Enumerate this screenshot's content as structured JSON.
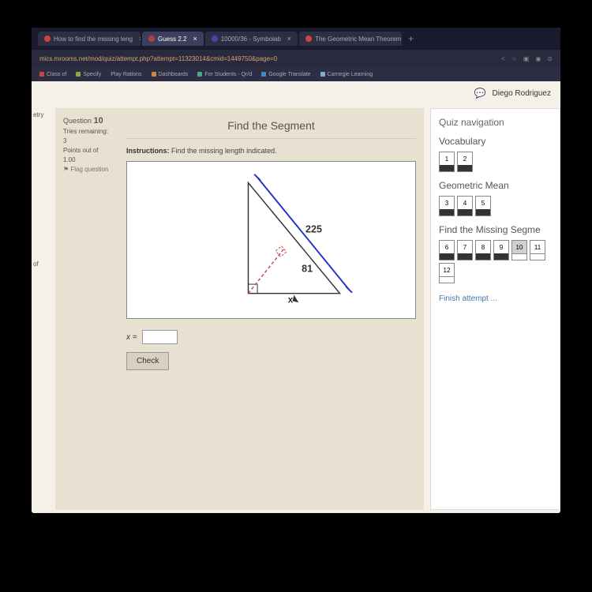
{
  "browser": {
    "tabs": [
      {
        "label": "How to find the missing leng",
        "active": false
      },
      {
        "label": "Guess 2.2",
        "active": true
      },
      {
        "label": "10000/36 - Symbolab",
        "active": false
      },
      {
        "label": "The Geometric Mean Theorem",
        "active": false
      }
    ],
    "url": "mics.mrooms.net/mod/quiz/attempt.php?attempt=11323014&cmid=1449750&page=0"
  },
  "bookmarks": [
    {
      "label": "Class of",
      "color": "#c44"
    },
    {
      "label": "Specify",
      "color": "#8a4"
    },
    {
      "label": "Play Rations",
      "color": "#888"
    },
    {
      "label": "Dashboards",
      "color": "#c84"
    },
    {
      "label": "For Students - Qr/d",
      "color": "#4a8"
    },
    {
      "label": "Google Translate",
      "color": "#48c"
    },
    {
      "label": "Carnegie Learning",
      "color": "#8ac"
    }
  ],
  "user": {
    "name": "Diego Rodriguez"
  },
  "leftNav": {
    "item1": "etry",
    "item2": "of"
  },
  "question": {
    "number": "10",
    "questionLabel": "Question",
    "triesLabel": "Tries remaining:",
    "triesValue": "3",
    "pointsLabel": "Points out of",
    "pointsValue": "1.00",
    "flagLabel": "⚑ Flag question",
    "title": "Find the Segment",
    "instructionsLabel": "Instructions:",
    "instructionsText": "Find the missing length indicated.",
    "figure": {
      "hypotenuse": "225",
      "segment": "81",
      "unknown": "x"
    },
    "answerVar": "x =",
    "checkLabel": "Check"
  },
  "navPanel": {
    "title": "Quiz navigation",
    "sections": [
      {
        "title": "Vocabulary",
        "items": [
          "1",
          "2"
        ],
        "done": [
          true,
          true
        ]
      },
      {
        "title": "Geometric Mean",
        "items": [
          "3",
          "4",
          "5"
        ],
        "done": [
          true,
          true,
          true
        ]
      },
      {
        "title": "Find the Missing Segme",
        "items": [
          "6",
          "7",
          "8",
          "9",
          "10",
          "11",
          "12"
        ],
        "done": [
          true,
          true,
          true,
          true,
          false,
          false,
          false
        ],
        "current": 4
      }
    ],
    "finish": "Finish attempt ..."
  }
}
